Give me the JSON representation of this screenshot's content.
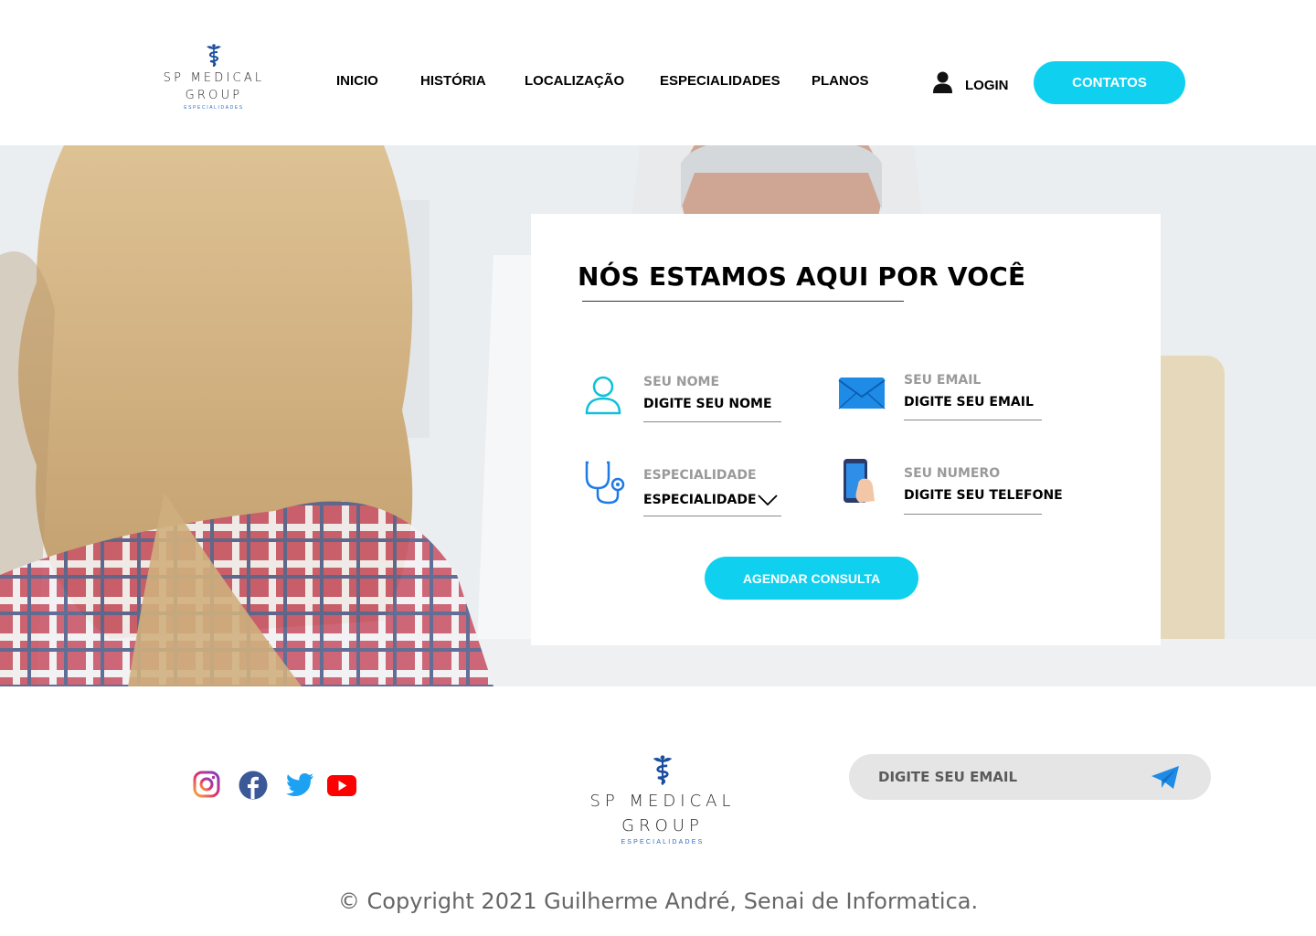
{
  "brand": {
    "line1": "SP MEDICAL",
    "line2": "GROUP",
    "line3": "ESPECIALIDADES",
    "color": "#1a4fa0"
  },
  "nav": {
    "items": [
      {
        "label": "INICIO"
      },
      {
        "label": "HISTÓRIA"
      },
      {
        "label": "LOCALIZAÇÃO"
      },
      {
        "label": "ESPECIALIDADES"
      },
      {
        "label": "PLANOS"
      }
    ]
  },
  "header": {
    "login_label": "LOGIN",
    "login_icon": "user-icon",
    "contatos_label": "CONTATOS"
  },
  "colors": {
    "accent": "#0fd0ef",
    "muted_label": "#9a9a9a"
  },
  "form": {
    "title": "NÓS ESTAMOS AQUI POR VOCÊ",
    "fields": {
      "nome": {
        "label": "SEU NOME",
        "value": "DIGITE SEU NOME",
        "icon": "user-outline-icon"
      },
      "email": {
        "label": "SEU EMAIL",
        "value": "DIGITE SEU EMAIL",
        "icon": "envelope-icon"
      },
      "especialidade": {
        "label": "ESPECIALIDADE",
        "value": "ESPECIALIDADE",
        "icon": "stethoscope-icon"
      },
      "numero": {
        "label": "SEU NUMERO",
        "value": "DIGITE SEU TELEFONE",
        "icon": "phone-icon"
      }
    },
    "submit_label": "AGENDAR CONSULTA"
  },
  "footer": {
    "social": [
      "instagram-icon",
      "facebook-icon",
      "twitter-icon",
      "youtube-icon"
    ],
    "newsletter_placeholder": "DIGITE SEU EMAIL",
    "send_icon": "send-icon",
    "copyright": "© Copyright 2021 Guilherme André, Senai de Informatica."
  }
}
